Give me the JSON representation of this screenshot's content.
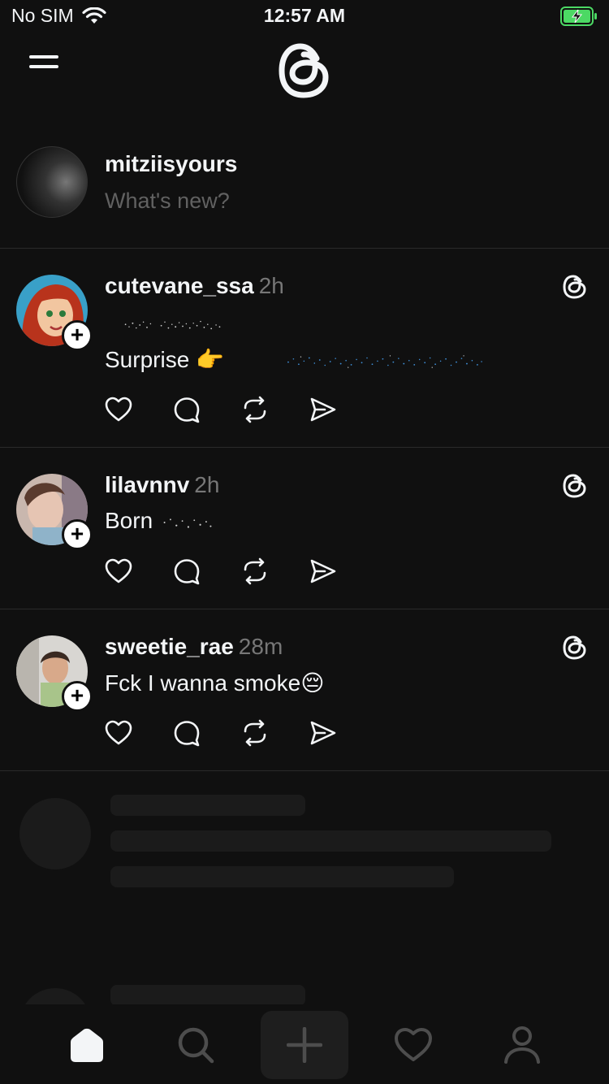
{
  "status_bar": {
    "carrier": "No SIM",
    "time": "12:57 AM"
  },
  "composer": {
    "username": "mitziisyours",
    "placeholder": "What's new?"
  },
  "posts": [
    {
      "username": "cutevane_ssa",
      "time": "2h",
      "text_line2": "Surprise 👉",
      "action_icons": [
        "heart-icon",
        "comment-icon",
        "repost-icon",
        "share-icon"
      ]
    },
    {
      "username": "lilavnnv",
      "time": "2h",
      "text": "Born"
    },
    {
      "username": "sweetie_rae",
      "time": "28m",
      "text": "Fck I wanna smoke😔"
    }
  ],
  "tabs": [
    "home-icon",
    "search-icon",
    "compose-icon",
    "activity-heart-icon",
    "profile-icon"
  ],
  "colors": {
    "background": "#101010",
    "text": "#f3f5f7",
    "muted": "#777777",
    "placeholder": "#616161",
    "skeleton": "#1b1b1b",
    "battery": "#4cd964"
  }
}
